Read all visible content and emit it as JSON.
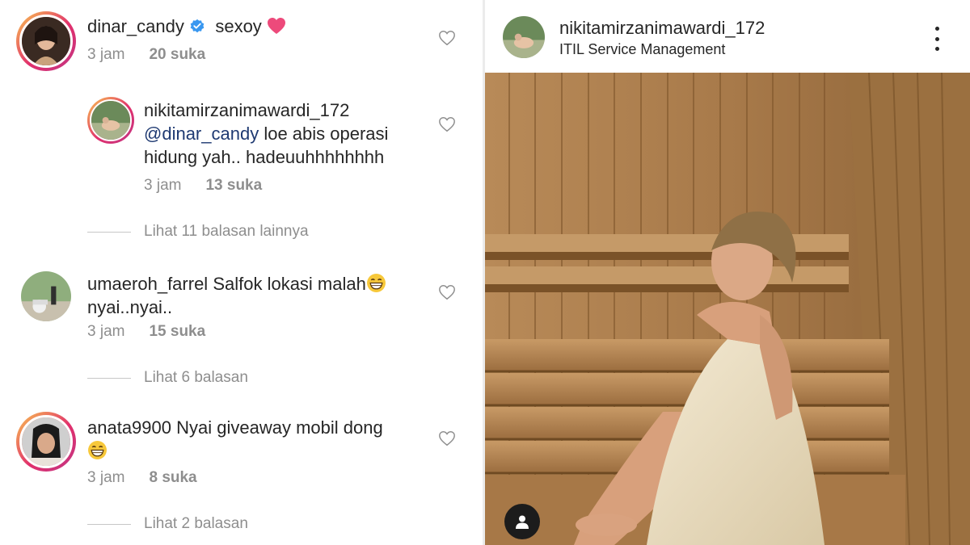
{
  "comments": [
    {
      "username": "dinar_candy",
      "text": "sexoy",
      "time": "3 jam",
      "likes": "20 suka"
    },
    {
      "username": "nikitamirzanimawardi_172",
      "mention": "@dinar_candy",
      "text_line1": "loe abis operasi",
      "text_line2": "hidung yah.. hadeuuhhhhhhhh",
      "time": "3 jam",
      "likes": "13 suka",
      "view_replies": "Lihat 11 balasan lainnya"
    },
    {
      "username": "umaeroh_farrel",
      "text_line1": "Salfok lokasi malah",
      "text_line2": "nyai..nyai..",
      "time": "3 jam",
      "likes": "15 suka",
      "view_replies": "Lihat 6 balasan"
    },
    {
      "username": "anata9900",
      "text_line1": "Nyai giveaway mobil dong",
      "time": "3 jam",
      "likes": "8 suka",
      "view_replies": "Lihat 2 balasan"
    }
  ],
  "post": {
    "username": "nikitamirzanimawardi_172",
    "location": "ITIL Service Management"
  },
  "colors": {
    "verified_blue": "#3897f0",
    "heart_pink": "#ed4a7b",
    "meta_gray": "#8e8e8e",
    "text": "#262626"
  },
  "icons": [
    "verified-icon",
    "heart-emoji-icon",
    "like-heart-icon",
    "grin-emoji-icon",
    "more-options-icon",
    "user-tag-icon"
  ]
}
